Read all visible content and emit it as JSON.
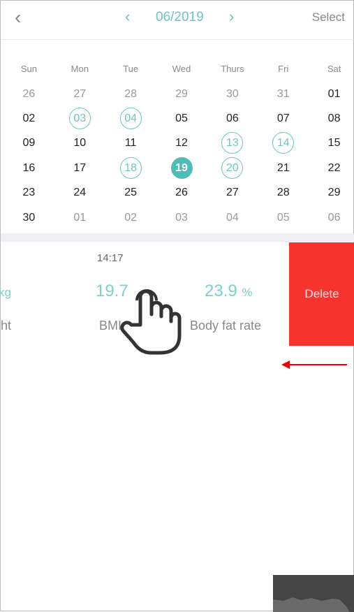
{
  "header": {
    "back_icon": "chevron-left-icon",
    "prev_icon": "chevron-left-icon",
    "month": "06/2019",
    "next_icon": "chevron-right-icon",
    "select": "Select"
  },
  "calendar": {
    "weekdays": [
      "Sun",
      "Mon",
      "Tue",
      "Wed",
      "Thurs",
      "Fri",
      "Sat"
    ],
    "weeks": [
      [
        {
          "d": "26",
          "s": "other"
        },
        {
          "d": "27",
          "s": "other"
        },
        {
          "d": "28",
          "s": "other"
        },
        {
          "d": "29",
          "s": "other"
        },
        {
          "d": "30",
          "s": "other"
        },
        {
          "d": "31",
          "s": "other"
        },
        {
          "d": "01",
          "s": ""
        }
      ],
      [
        {
          "d": "02",
          "s": ""
        },
        {
          "d": "03",
          "s": "mark"
        },
        {
          "d": "04",
          "s": "mark"
        },
        {
          "d": "05",
          "s": ""
        },
        {
          "d": "06",
          "s": ""
        },
        {
          "d": "07",
          "s": ""
        },
        {
          "d": "08",
          "s": ""
        }
      ],
      [
        {
          "d": "09",
          "s": ""
        },
        {
          "d": "10",
          "s": ""
        },
        {
          "d": "11",
          "s": ""
        },
        {
          "d": "12",
          "s": ""
        },
        {
          "d": "13",
          "s": "mark"
        },
        {
          "d": "14",
          "s": "mark"
        },
        {
          "d": "15",
          "s": ""
        }
      ],
      [
        {
          "d": "16",
          "s": ""
        },
        {
          "d": "17",
          "s": ""
        },
        {
          "d": "18",
          "s": "mark"
        },
        {
          "d": "19",
          "s": "sel"
        },
        {
          "d": "20",
          "s": "mark"
        },
        {
          "d": "21",
          "s": ""
        },
        {
          "d": "22",
          "s": ""
        }
      ],
      [
        {
          "d": "23",
          "s": ""
        },
        {
          "d": "24",
          "s": ""
        },
        {
          "d": "25",
          "s": ""
        },
        {
          "d": "26",
          "s": ""
        },
        {
          "d": "27",
          "s": ""
        },
        {
          "d": "28",
          "s": ""
        },
        {
          "d": "29",
          "s": ""
        }
      ],
      [
        {
          "d": "30",
          "s": ""
        },
        {
          "d": "01",
          "s": "other"
        },
        {
          "d": "02",
          "s": "other"
        },
        {
          "d": "03",
          "s": "other"
        },
        {
          "d": "04",
          "s": "other"
        },
        {
          "d": "05",
          "s": "other"
        },
        {
          "d": "06",
          "s": "other"
        }
      ]
    ],
    "accent": "#4dbdb8"
  },
  "record": {
    "time": "14:17",
    "weight_unit": "kg",
    "weight_label": "ht",
    "bmi": "19.7",
    "bmi_label": "BMI",
    "fat": "23.9",
    "fat_unit": "%",
    "fat_label": "Body fat rate",
    "delete": "Delete",
    "delete_color": "#f5352d"
  },
  "overlay": {
    "hand_icon": "tap-hand-icon",
    "arrow_icon": "swipe-left-arrow-icon"
  }
}
